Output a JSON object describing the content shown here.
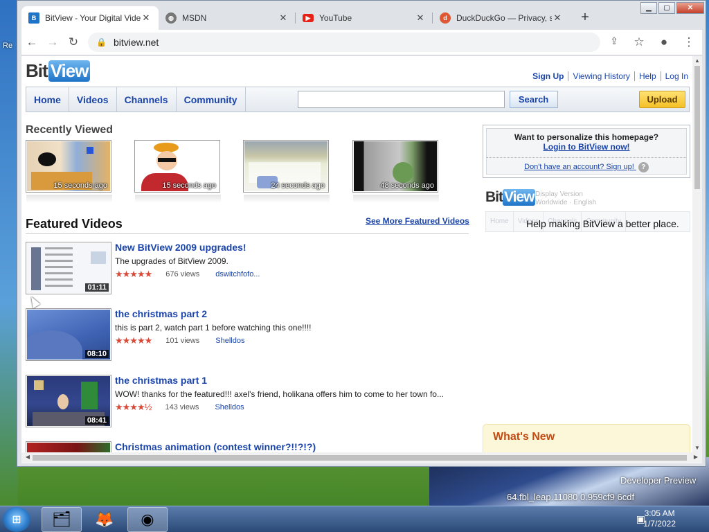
{
  "desktop": {
    "watermark_line1": "Developer Preview",
    "watermark_line2": "64.fbl_leap.11080 0.959cf9 6cdf",
    "left_edge_text": "Re"
  },
  "browser": {
    "tabs": [
      {
        "title": "BitView - Your Digital Video",
        "icon": "bitview-favicon",
        "active": true
      },
      {
        "title": "MSDN",
        "icon": "globe-icon",
        "active": false
      },
      {
        "title": "YouTube",
        "icon": "youtube-icon",
        "active": false
      },
      {
        "title": "DuckDuckGo — Privacy, simplified",
        "icon": "duckduckgo-icon",
        "active": false
      }
    ],
    "url": "bitview.net"
  },
  "site": {
    "logo_bit": "Bit",
    "logo_view": "View",
    "user_links": [
      "Sign Up",
      "Viewing History",
      "Help",
      "Log In"
    ],
    "nav": [
      "Home",
      "Videos",
      "Channels",
      "Community"
    ],
    "search_button": "Search",
    "upload_button": "Upload",
    "recently_viewed_heading": "Recently Viewed",
    "recently_viewed": [
      {
        "time": "15 seconds ago"
      },
      {
        "time": "15 seconds ago"
      },
      {
        "time": "24 seconds ago"
      },
      {
        "time": "48 seconds ago"
      }
    ],
    "featured_heading": "Featured Videos",
    "see_more": "See More Featured Videos",
    "featured": [
      {
        "title": "New BitView 2009 upgrades!",
        "description": "The upgrades of BitView 2009.",
        "stars": "★★★★★",
        "views": "676 views",
        "uploader": "dswitchfofo...",
        "duration": "01:11"
      },
      {
        "title": "the christmas part 2",
        "description": "this is part 2, watch part 1 before watching this one!!!!",
        "stars": "★★★★★",
        "views": "101 views",
        "uploader": "Shelldos",
        "duration": "08:10"
      },
      {
        "title": "the christmas part 1",
        "description": "WOW! thanks for the featured!!! axel's friend, holikana offers him to come to her town fo...",
        "stars": "★★★★½",
        "views": "143 views",
        "uploader": "Shelldos",
        "duration": "08:41"
      },
      {
        "title": "Christmas animation (contest winner?!!?!?)"
      }
    ],
    "sidebar": {
      "question": "Want to personalize this homepage?",
      "login_link": "Login to BitView now!",
      "signup_link": "Don't have an account? Sign up!",
      "help_glyph": "?"
    },
    "preview": {
      "small_line1": "Display Version",
      "small_line2": "Worldwide · English",
      "nav": [
        "Home",
        "Videos",
        "Channels",
        "Community"
      ]
    },
    "tooltip": "Help making BitView a better place.",
    "whats_new": "What's New"
  },
  "taskbar": {
    "time": "3:05 AM",
    "date": "1/7/2022"
  }
}
